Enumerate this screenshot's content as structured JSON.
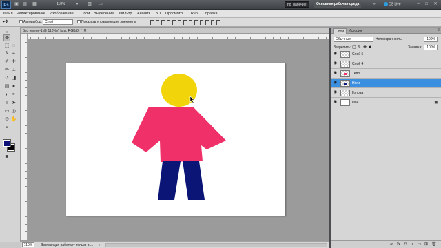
{
  "app": {
    "logo_text": "Ps",
    "zoom_display": "110%",
    "workspace_buttons": [
      "по_рабочие",
      "Основная рабочая среда"
    ],
    "cs_live": "CS Live"
  },
  "menu": [
    "Файл",
    "Редактирование",
    "Изображение",
    "Слои",
    "Выделение",
    "Фильтр",
    "Анализ",
    "3D",
    "Просмотр",
    "Окно",
    "Справка"
  ],
  "options_bar": {
    "autoselect_label": "Автовыбор:",
    "autoselect_value": "Слой",
    "show_controls_label": "Показать управляющие элементы"
  },
  "document": {
    "tab_title": "Без имени-1 @ 110% (Ноги, RGB/8) *"
  },
  "status": {
    "zoom": "110%",
    "text": "Экспозиция работает только в ..."
  },
  "layers_panel": {
    "tabs": [
      "Слои",
      "История"
    ],
    "blend_mode": "Обычные",
    "opacity_label": "Непрозрачность:",
    "opacity_value": "100%",
    "lock_label": "Закрепить:",
    "fill_label": "Заливка:",
    "fill_value": "100%",
    "layers": [
      {
        "name": "Слой 5",
        "selected": false,
        "thumb_color": ""
      },
      {
        "name": "Слой 4",
        "selected": false,
        "thumb_color": ""
      },
      {
        "name": "Тело",
        "selected": false,
        "thumb_color": "#f0306a"
      },
      {
        "name": "Ноги",
        "selected": true,
        "thumb_color": "#0b1a7a"
      },
      {
        "name": "Голова",
        "selected": false,
        "thumb_color": ""
      },
      {
        "name": "Фон",
        "selected": false,
        "thumb_color": "#ffffff"
      }
    ]
  },
  "colors": {
    "head": "#f2d40b",
    "body": "#f03068",
    "legs": "#0b1576",
    "foreground": "#0b0f78",
    "background_swatch": "#000000",
    "selection": "#3b8fe0"
  }
}
